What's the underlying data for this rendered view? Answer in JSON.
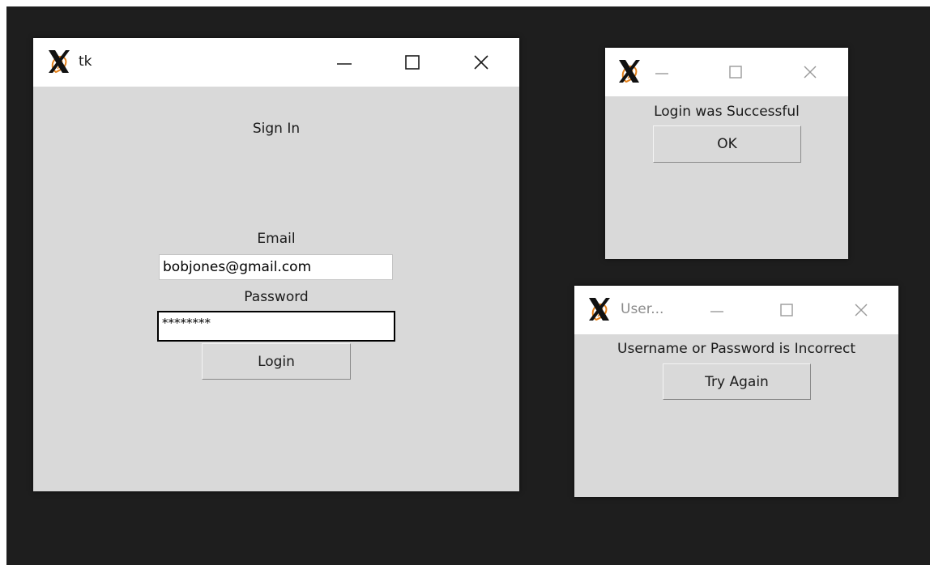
{
  "colors": {
    "desktop": "#1e1e1e",
    "window_bg": "#d9d9d9",
    "titlebar_bg": "#ffffff",
    "tk_logo_x": "#111111",
    "tk_logo_feather": "#e5821c"
  },
  "icons": {
    "app": "tk-feather-icon",
    "minimize": "minimize-icon",
    "maximize": "maximize-icon",
    "close": "close-icon"
  },
  "login_window": {
    "title": "tk",
    "heading": "Sign In",
    "email_label": "Email",
    "email_value": "bobjones@gmail.com",
    "password_label": "Password",
    "password_value": "********",
    "login_button": "Login"
  },
  "success_dialog": {
    "title": "",
    "message": "Login was Successful",
    "ok_button": "OK"
  },
  "error_dialog": {
    "title": "User...",
    "message": "Username or Password is Incorrect",
    "retry_button": "Try Again"
  }
}
